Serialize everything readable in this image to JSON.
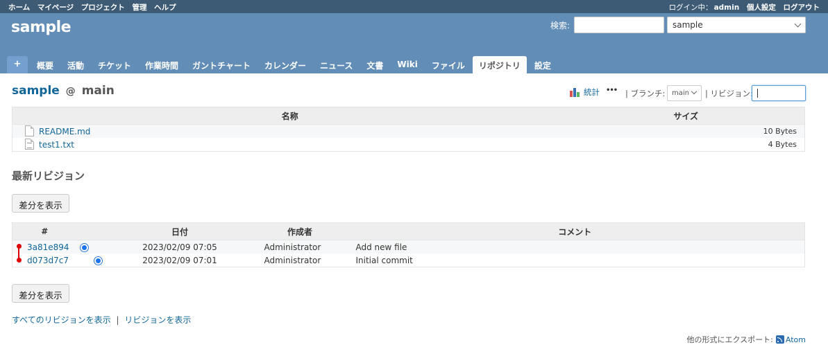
{
  "top_menu": {
    "left": [
      "ホーム",
      "マイページ",
      "プロジェクト",
      "管理",
      "ヘルプ"
    ],
    "logged_as_label": "ログイン中：",
    "user": "admin",
    "my_account": "個人設定",
    "logout": "ログアウト"
  },
  "header": {
    "title": "sample",
    "search_label": "検索:",
    "search_value": "",
    "project_jump": "sample"
  },
  "main_menu": {
    "new": "+",
    "tabs": [
      "概要",
      "活動",
      "チケット",
      "作業時間",
      "ガントチャート",
      "カレンダー",
      "ニュース",
      "文書",
      "Wiki",
      "ファイル",
      "リポジトリ",
      "設定"
    ],
    "selected": "リポジトリ"
  },
  "repository": {
    "project": "sample",
    "at": "@",
    "branch_name": "main",
    "stats_label": "統計",
    "more": "•••",
    "branch_label": "| ブランチ:",
    "branch_value": "main",
    "revision_label": "| リビジョン:",
    "revision_value": ""
  },
  "entries": {
    "headers": [
      "名称",
      "サイズ"
    ],
    "rows": [
      {
        "name": "README.md",
        "size": "10 Bytes"
      },
      {
        "name": "test1.txt",
        "size": "4 Bytes"
      }
    ]
  },
  "latest": {
    "title": "最新リビジョン",
    "diff_button": "差分を表示",
    "headers": [
      "#",
      "日付",
      "作成者",
      "コメント"
    ],
    "rows": [
      {
        "rev": "3a81e894",
        "date": "2023/02/09 07:05",
        "author": "Administrator",
        "comment": "Add new file"
      },
      {
        "rev": "d073d7c7",
        "date": "2023/02/09 07:01",
        "author": "Administrator",
        "comment": "Initial commit"
      }
    ]
  },
  "links": {
    "all_revisions": "すべてのリビジョンを表示",
    "separator": "|",
    "view_revisions": "リビジョンを表示"
  },
  "export": {
    "label": "他の形式にエクスポート:",
    "atom": "Atom"
  },
  "colors": {
    "header_bg": "#628db6",
    "top_menu_bg": "#3e5b76",
    "link": "#169",
    "graph": "#dd0000"
  }
}
